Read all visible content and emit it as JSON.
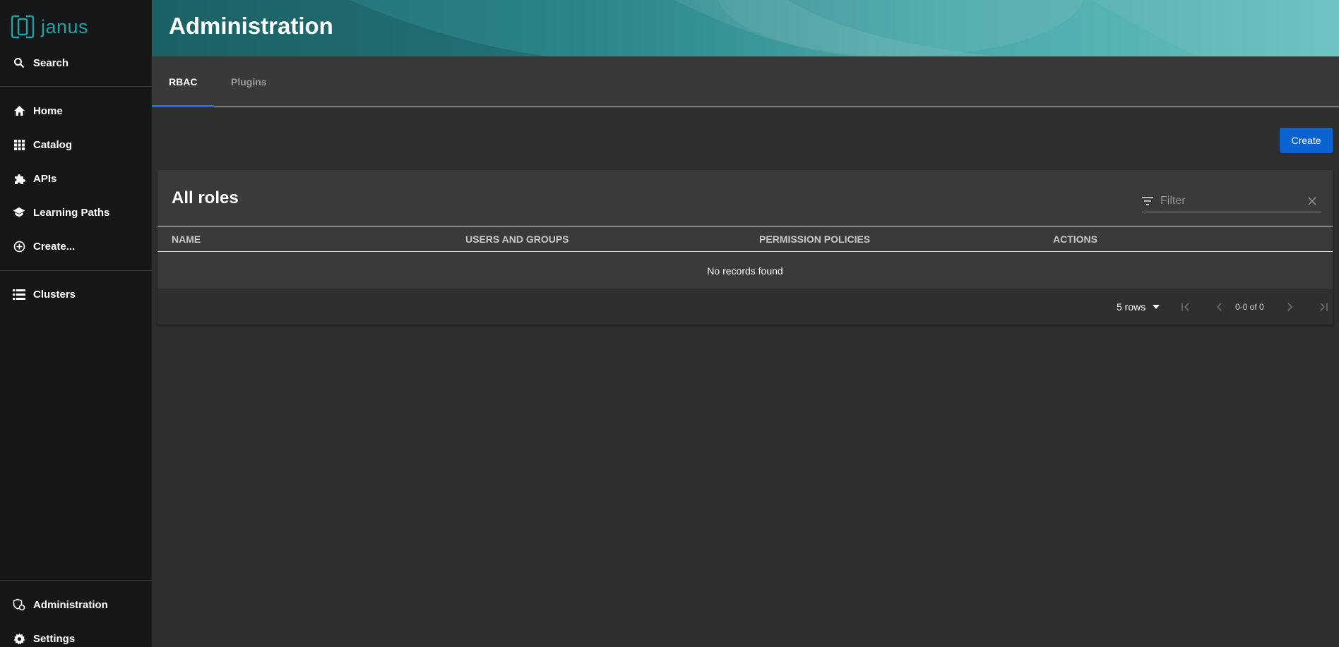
{
  "app": {
    "logo_text": "janus"
  },
  "sidebar": {
    "top_items": [
      {
        "label": "Search",
        "icon": "search-icon"
      },
      {
        "label": "Home",
        "icon": "home-icon"
      },
      {
        "label": "Catalog",
        "icon": "grid-icon"
      },
      {
        "label": "APIs",
        "icon": "puzzle-icon"
      },
      {
        "label": "Learning Paths",
        "icon": "school-icon"
      },
      {
        "label": "Create...",
        "icon": "add-circle-icon"
      },
      {
        "label": "Clusters",
        "icon": "list-icon"
      }
    ],
    "bottom_items": [
      {
        "label": "Administration",
        "icon": "admin-icon"
      },
      {
        "label": "Settings",
        "icon": "gear-icon"
      }
    ]
  },
  "header": {
    "title": "Administration"
  },
  "tabs": [
    {
      "label": "RBAC",
      "active": true
    },
    {
      "label": "Plugins",
      "active": false
    }
  ],
  "toolbar": {
    "create_label": "Create"
  },
  "roles_table": {
    "title": "All roles",
    "filter_placeholder": "Filter",
    "columns": [
      "NAME",
      "USERS AND GROUPS",
      "PERMISSION POLICIES",
      "ACTIONS"
    ],
    "empty_message": "No records found",
    "pagination": {
      "rows_per_page": "5 rows",
      "range": "0-0 of 0"
    }
  },
  "colors": {
    "accent": "#0b63d1",
    "brand": "#1fa3a8",
    "sidebar_bg": "#151618",
    "content_bg": "#2e2e2e"
  }
}
